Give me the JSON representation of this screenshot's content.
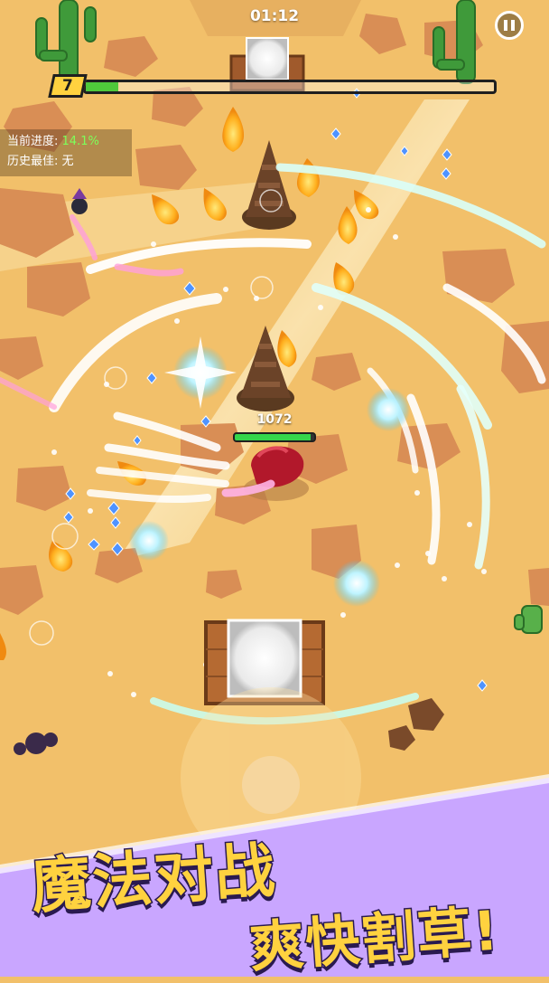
{
  "hud": {
    "timer": "01:12",
    "level": "7",
    "xp_progress": 0.08,
    "progress_label": "当前进度:",
    "progress_value": "14.1%",
    "best_label": "历史最佳:",
    "best_value": "无"
  },
  "boss": {
    "hp_text": "1072",
    "hp_fraction": 0.95
  },
  "banner": {
    "line1": "魔法对战",
    "line2": "爽快割草!"
  },
  "colors": {
    "sand": "#f2c06a",
    "rock": "#d98e55",
    "banner": "#c9a6ff",
    "slogan": "#ffd23f",
    "hp_green": "#35d64b",
    "xp_green": "#4fc93b",
    "gem": "#4f93ff"
  },
  "icons": [
    "pause-icon",
    "cactus-icon",
    "spike-tower-icon",
    "flame-monster-icon",
    "gem-icon",
    "magic-orb-icon",
    "spawn-pad-icon"
  ]
}
